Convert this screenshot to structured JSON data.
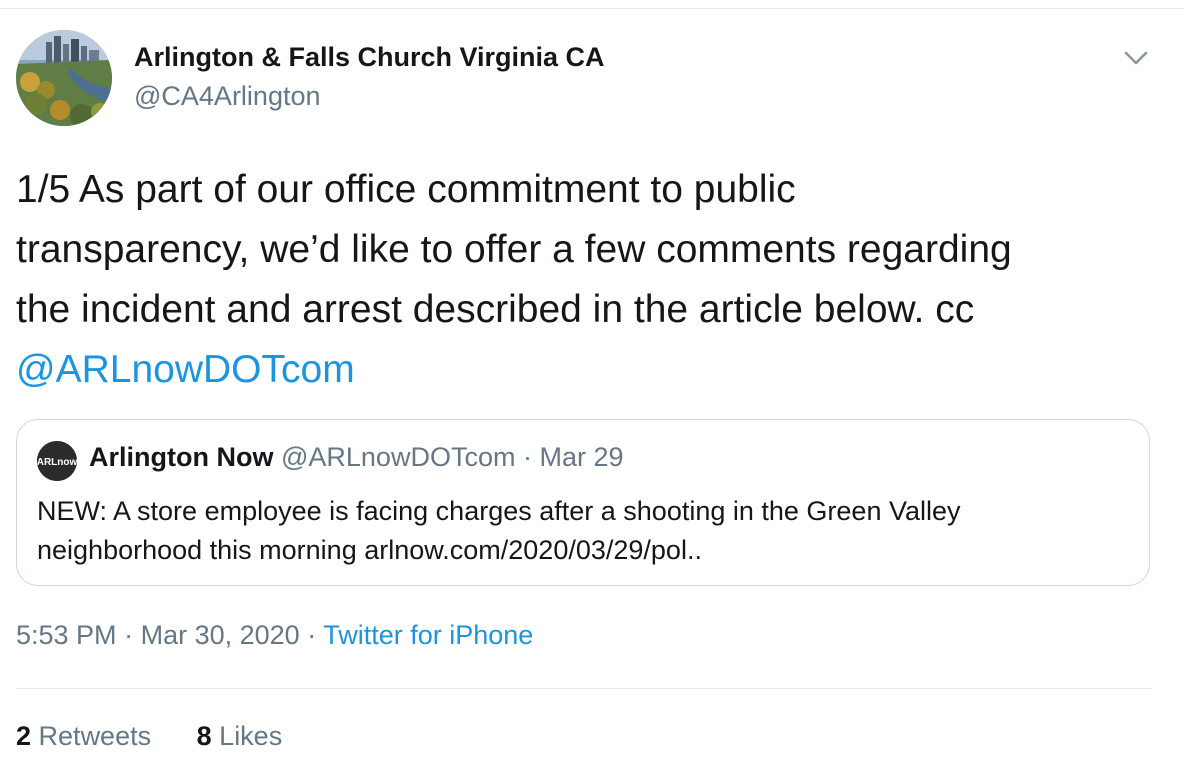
{
  "author": {
    "display_name": "Arlington & Falls Church Virginia CA",
    "handle": "@CA4Arlington"
  },
  "tweet": {
    "lines": [
      "1/5 As part of our office commitment to public",
      "transparency, we’d like to offer a few comments regarding",
      "the incident and arrest described in the  article below. cc"
    ],
    "mention": "@ARLnowDOTcom"
  },
  "quote": {
    "avatar_text": "ARLnow",
    "name": "Arlington Now",
    "handle": "@ARLnowDOTcom",
    "separator": "·",
    "date": "Mar 29",
    "lines": [
      "NEW: A store employee is facing charges after a shooting in the Green Valley",
      "neighborhood this morning arlnow.com/2020/03/29/pol.."
    ]
  },
  "meta": {
    "time": "5:53 PM",
    "sep1": "·",
    "date": "Mar 30, 2020",
    "sep2": "·",
    "source": "Twitter for iPhone"
  },
  "stats": {
    "retweets_count": "2",
    "retweets_label": "Retweets",
    "likes_count": "8",
    "likes_label": "Likes"
  },
  "icons": {
    "caret": "chevron-down-icon"
  },
  "colors": {
    "link": "#1b95e0",
    "secondary_text": "#657786",
    "border": "#ccd6dd"
  }
}
